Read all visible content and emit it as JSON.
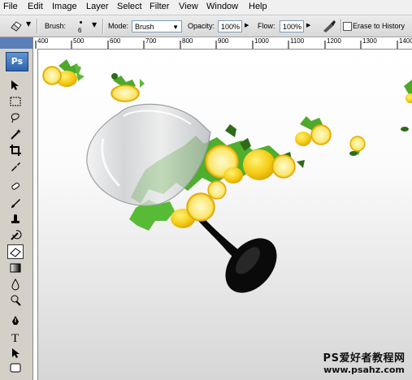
{
  "menubar": {
    "items": [
      "File",
      "Edit",
      "Image",
      "Layer",
      "Select",
      "Filter",
      "View",
      "Window",
      "Help"
    ]
  },
  "options": {
    "brush_label": "Brush:",
    "brush_size": "6",
    "mode_label": "Mode:",
    "mode_value": "Brush",
    "opacity_label": "Opacity:",
    "opacity_value": "100%",
    "flow_label": "Flow:",
    "flow_value": "100%",
    "erase_history_label": "Erase to History",
    "erase_history_checked": false
  },
  "ruler": {
    "ticks": [
      "400",
      "500",
      "600",
      "700",
      "800",
      "900",
      "1000",
      "1100",
      "1200",
      "1300",
      "1400"
    ]
  },
  "toolbox": {
    "logo": "Ps",
    "active_tool": "eraser"
  },
  "watermark": {
    "line1": "PS爱好者教程网",
    "line2": "www.psahz.com"
  },
  "colors": {
    "accent": "#5a7eb8",
    "lemon": "#f4d21c",
    "leaf": "#4ca82a",
    "stem": "#0a0a0a"
  }
}
